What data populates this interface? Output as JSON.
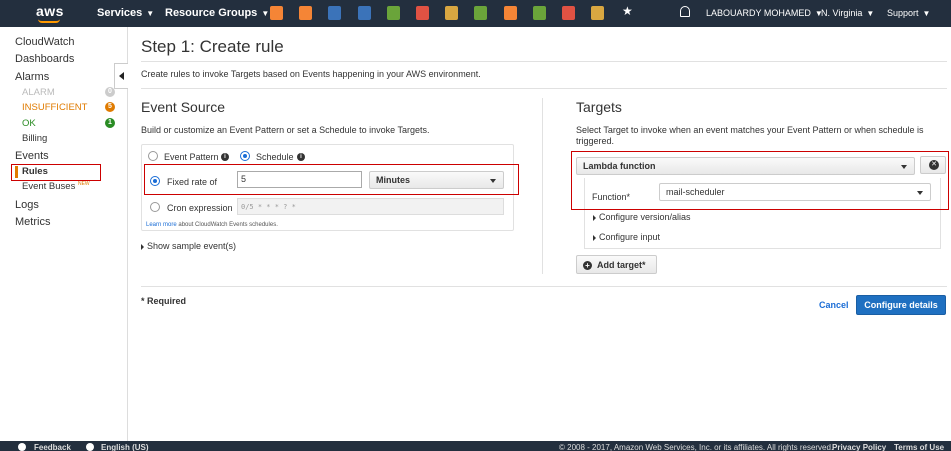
{
  "topbar": {
    "logo": "aws",
    "services": "Services",
    "resource_groups": "Resource Groups",
    "user": "LABOUARDY MOHAMED",
    "region": "N. Virginia",
    "support": "Support",
    "service_icons": [
      {
        "name": "ec2-icon",
        "color": "#f58536"
      },
      {
        "name": "lambda-icon",
        "color": "#f58536"
      },
      {
        "name": "s3-icon",
        "color": "#3b73b9"
      },
      {
        "name": "dynamodb-icon",
        "color": "#3b73b9"
      },
      {
        "name": "beanstalk-icon",
        "color": "#6aa43a"
      },
      {
        "name": "codedeploy-icon",
        "color": "#e05243"
      },
      {
        "name": "storage-icon",
        "color": "#d9a741"
      },
      {
        "name": "cloudsearch-icon",
        "color": "#6aa43a"
      },
      {
        "name": "api-gateway-icon",
        "color": "#f58536"
      },
      {
        "name": "cloudformation-icon",
        "color": "#6aa43a"
      },
      {
        "name": "cloudwatch-icon",
        "color": "#e05243"
      },
      {
        "name": "workflow-icon",
        "color": "#d9a741"
      }
    ]
  },
  "sidebar": {
    "cloudwatch": "CloudWatch",
    "dashboards": "Dashboards",
    "alarms": "Alarms",
    "alarm": "ALARM",
    "alarm_count": "0",
    "insufficient": "INSUFFICIENT",
    "insufficient_count": "5",
    "ok": "OK",
    "ok_count": "1",
    "billing": "Billing",
    "events": "Events",
    "rules": "Rules",
    "event_buses": "Event Buses",
    "new_badge": "NEW",
    "logs": "Logs",
    "metrics": "Metrics"
  },
  "page": {
    "title": "Step 1: Create rule",
    "intro": "Create rules to invoke Targets based on Events happening in your AWS environment."
  },
  "event_source": {
    "heading": "Event Source",
    "desc": "Build or customize an Event Pattern or set a Schedule to invoke Targets.",
    "event_pattern": "Event Pattern",
    "schedule": "Schedule",
    "fixed_rate": "Fixed rate of",
    "rate_value": "5",
    "rate_unit": "Minutes",
    "cron": "Cron expression",
    "cron_placeholder": "0/5 * * * ? *",
    "learn_more": "Learn more",
    "learn_more_rest": " about CloudWatch Events schedules.",
    "show_sample": "Show sample event(s)"
  },
  "targets": {
    "heading": "Targets",
    "desc": "Select Target to invoke when an event matches your Event Pattern or when schedule is triggered.",
    "target_type": "Lambda function",
    "function_label": "Function*",
    "function_value": "mail-scheduler",
    "configure_version": "Configure version/alias",
    "configure_input": "Configure input",
    "add_target": "Add target*"
  },
  "footer_actions": {
    "required": "* Required",
    "cancel": "Cancel",
    "configure": "Configure details"
  },
  "footer": {
    "feedback": "Feedback",
    "language": "English (US)",
    "copyright": "© 2008 - 2017, Amazon Web Services, Inc. or its affiliates. All rights reserved.",
    "privacy": "Privacy Policy",
    "terms": "Terms of Use"
  }
}
